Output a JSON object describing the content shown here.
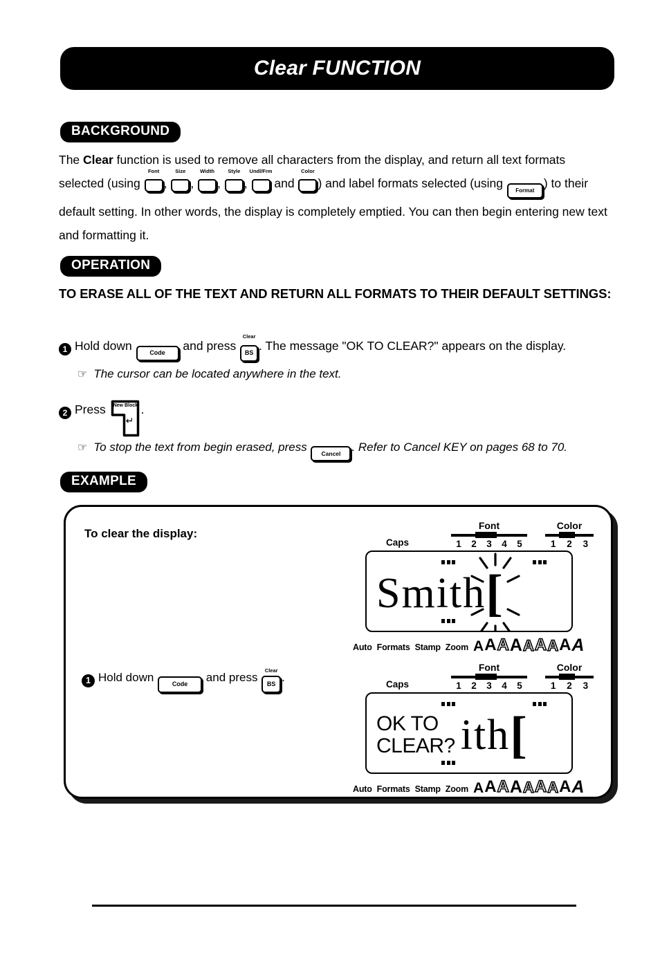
{
  "document": {
    "title": "Clear FUNCTION"
  },
  "sections": {
    "background": {
      "pill_label": "BACKGROUND",
      "text_part_1": "The ",
      "text_bold": "Clear",
      "text_part_2": " function is used to remove all characters from the display, and return all text formats selected (using ",
      "text_part_3": ", ",
      "text_and": " and ",
      "text_part_4": ") and label formats selected (using ",
      "text_part_5": ") to their default setting.  In other words, the display is completely emptied.  You can then begin entering new text and formatting it.",
      "format_keys": [
        {
          "top_label": "Font",
          "name": "font-key"
        },
        {
          "top_label": "Size",
          "name": "size-key"
        },
        {
          "top_label": "Width",
          "name": "width-key"
        },
        {
          "top_label": "Style",
          "name": "style-key"
        },
        {
          "top_label": "Undl/Frm",
          "name": "undl-frm-key"
        },
        {
          "top_label": "Color",
          "name": "color-key"
        }
      ],
      "format_key_label": "Format"
    },
    "operation": {
      "pill_label": "OPERATION",
      "heading": "TO ERASE ALL OF THE TEXT AND RETURN ALL FORMATS TO THEIR DEFAULT SETTINGS:",
      "step_1": {
        "number": "1",
        "text_before": "Hold down ",
        "code_key_label": "Code",
        "text_middle": " and press ",
        "clear_key_top": "Clear",
        "clear_key_label": "BS",
        "text_after": ". The message \"OK TO CLEAR?\" appears on the display."
      },
      "note_1": {
        "icon": "pointing-hand-icon",
        "text": "The cursor can be located anywhere in the text."
      },
      "step_2": {
        "number": "2",
        "text_before": "Press ",
        "enter_key_top": "New Block",
        "enter_key_arrow": "↵",
        "text_after": "."
      },
      "note_2": {
        "icon": "pointing-hand-icon",
        "text_before": "To stop the text from begin erased, press ",
        "cancel_key_label": "Cancel",
        "text_after": ". Refer to Cancel KEY on pages 68 to 70."
      }
    },
    "example": {
      "pill_label": "EXAMPLE",
      "box_title": "To clear the display:",
      "step_1": {
        "number": "1",
        "text_before": "Hold down ",
        "code_key_label": "Code",
        "text_middle": " and press ",
        "clear_key_top": "Clear",
        "clear_key_label": "BS",
        "text_after": "."
      }
    }
  },
  "lcd_displays": [
    {
      "name": "lcd-before-clear",
      "caps_label": "Caps",
      "font_scale": {
        "label": "Font",
        "ticks": [
          "1",
          "2",
          "3",
          "4",
          "5"
        ],
        "selected": "2"
      },
      "color_scale": {
        "label": "Color",
        "ticks": [
          "1",
          "2",
          "3"
        ],
        "selected": "2"
      },
      "screen_text": "Smith",
      "message": "",
      "cursor": "[",
      "cursor_blinking": true,
      "bottom_labels": [
        "Auto",
        "Formats",
        "Stamp",
        "Zoom"
      ],
      "size_indicators": [
        "A",
        "A",
        "A",
        "A",
        "A",
        "A",
        "A",
        "A",
        "A",
        "A"
      ]
    },
    {
      "name": "lcd-after-clear-prompt",
      "caps_label": "Caps",
      "font_scale": {
        "label": "Font",
        "ticks": [
          "1",
          "2",
          "3",
          "4",
          "5"
        ],
        "selected": "2"
      },
      "color_scale": {
        "label": "Color",
        "ticks": [
          "1",
          "2",
          "3"
        ],
        "selected": "2"
      },
      "screen_text": "ith",
      "message": "OK TO\nCLEAR?",
      "cursor": "[",
      "cursor_blinking": false,
      "bottom_labels": [
        "Auto",
        "Formats",
        "Stamp",
        "Zoom"
      ],
      "size_indicators": [
        "A",
        "A",
        "A",
        "A",
        "A",
        "A",
        "A",
        "A",
        "A",
        "A"
      ]
    }
  ],
  "colors": {
    "ink": "#000000",
    "paper": "#ffffff"
  }
}
